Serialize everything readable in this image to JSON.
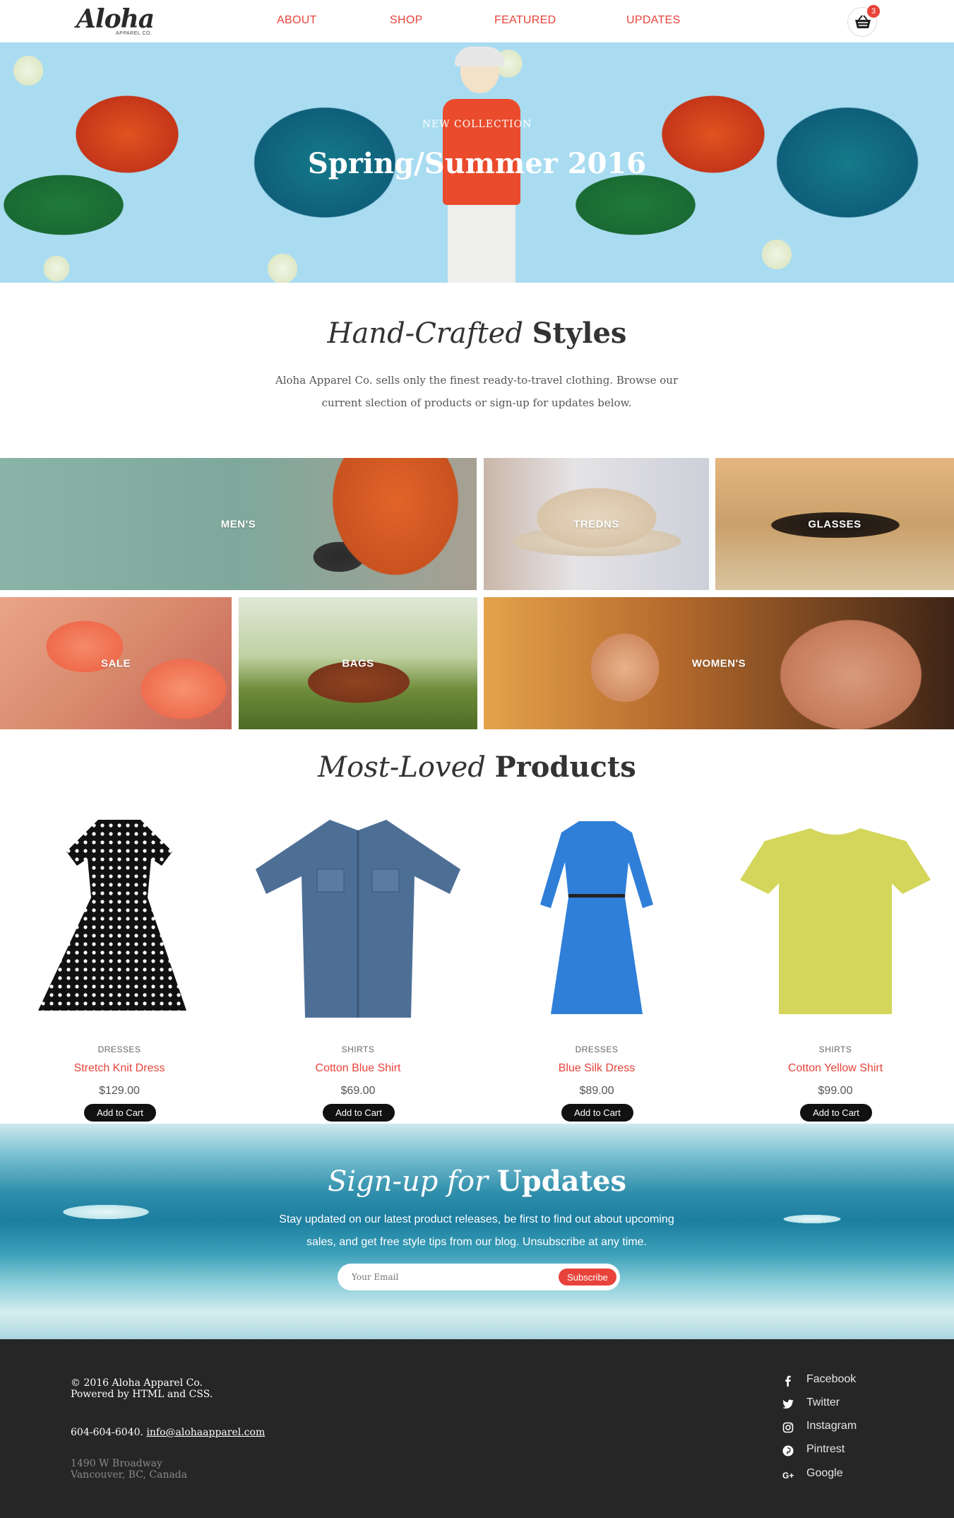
{
  "header": {
    "logo_script": "Aloha",
    "logo_sub": "APPAREL CO.",
    "nav": [
      "ABOUT",
      "SHOP",
      "FEATURED",
      "UPDATES"
    ],
    "cart_count": "3"
  },
  "hero": {
    "eyebrow": "NEW COLLECTION",
    "title": "Spring/Summer 2016"
  },
  "intro": {
    "title_italic": "Hand-Crafted",
    "title_bold": "Styles",
    "text": "Aloha Apparel Co. sells only the finest ready-to-travel clothing. Browse our current slection of products or sign-up for updates below."
  },
  "categories": [
    "MEN'S",
    "TREDNS",
    "GLASSES",
    "SALE",
    "BAGS",
    "WOMEN'S"
  ],
  "products_section": {
    "title_italic": "Most-Loved",
    "title_bold": "Products"
  },
  "products": [
    {
      "category": "DRESSES",
      "name": "Stretch Knit Dress",
      "price": "$129.00",
      "button": "Add to Cart"
    },
    {
      "category": "SHIRTS",
      "name": "Cotton Blue Shirt",
      "price": "$69.00",
      "button": "Add to Cart"
    },
    {
      "category": "DRESSES",
      "name": "Blue Silk Dress",
      "price": "$89.00",
      "button": "Add to Cart"
    },
    {
      "category": "SHIRTS",
      "name": "Cotton Yellow Shirt",
      "price": "$99.00",
      "button": "Add to Cart"
    }
  ],
  "signup": {
    "title_italic": "Sign-up for",
    "title_bold": "Updates",
    "text": "Stay updated on our latest product releases, be first to find out about upcoming sales, and get free style tips from our blog. Unsubscribe at any time.",
    "email_placeholder": "Your Email",
    "subscribe_label": "Subscribe"
  },
  "footer": {
    "copyright": "© 2016 Aloha Apparel Co.",
    "powered": "Powered by HTML and CSS.",
    "phone": "604-604-6040.",
    "email": "info@alohaapparel.com",
    "address_line1": "1490 W Broadway",
    "address_line2": "Vancouver, BC, Canada",
    "social": [
      {
        "label": "Facebook",
        "icon": "facebook-icon"
      },
      {
        "label": "Twitter",
        "icon": "twitter-icon"
      },
      {
        "label": "Instagram",
        "icon": "instagram-icon"
      },
      {
        "label": "Pintrest",
        "icon": "pinterest-icon"
      },
      {
        "label": "Google",
        "icon": "google-plus-icon"
      }
    ]
  },
  "colors": {
    "accent": "#e8433a",
    "footer_bg": "#262626",
    "button_bg": "#111111"
  }
}
